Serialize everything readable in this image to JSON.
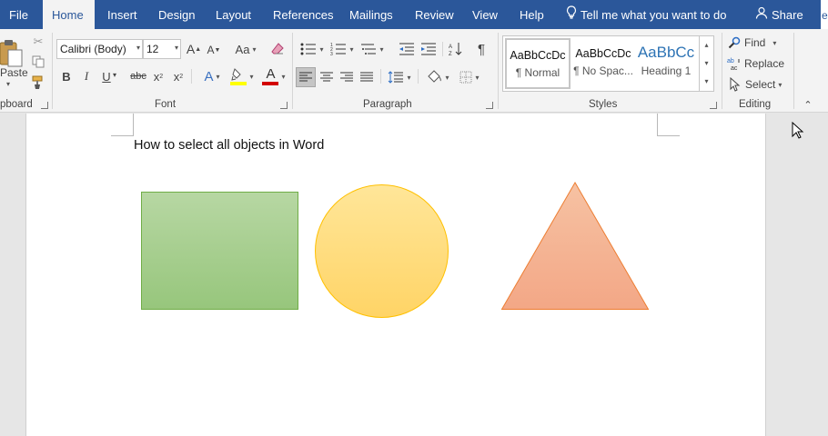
{
  "tabs": [
    {
      "label": "File",
      "active": false
    },
    {
      "label": "Home",
      "active": true
    },
    {
      "label": "Insert",
      "active": false
    },
    {
      "label": "Design",
      "active": false
    },
    {
      "label": "Layout",
      "active": false
    },
    {
      "label": "References",
      "active": false
    },
    {
      "label": "Mailings",
      "active": false
    },
    {
      "label": "Review",
      "active": false
    },
    {
      "label": "View",
      "active": false
    },
    {
      "label": "Help",
      "active": false
    }
  ],
  "tell_me": "Tell me what you want to do",
  "share": "Share",
  "edge_text": "e",
  "clipboard": {
    "paste_label": "Paste",
    "group_label": "pboard"
  },
  "font": {
    "family": "Calibri (Body)",
    "size": "12",
    "group_label": "Font",
    "grow_label": "A",
    "shrink_label": "A",
    "case_label": "Aa",
    "bold": "B",
    "italic": "I",
    "underline": "U",
    "strike": "abc",
    "subscript": "x",
    "superscript": "x",
    "effects": "A",
    "font_color": "A",
    "font_color_hex": "#d20000",
    "highlight_hex": "#ffff00"
  },
  "paragraph": {
    "group_label": "Paragraph",
    "pilcrow": "¶"
  },
  "styles": {
    "group_label": "Styles",
    "items": [
      {
        "sample": "AaBbCcDc",
        "name": "¶ Normal"
      },
      {
        "sample": "AaBbCcDc",
        "name": "¶ No Spac..."
      },
      {
        "sample": "AaBbCc",
        "name": "Heading 1"
      }
    ]
  },
  "editing": {
    "group_label": "Editing",
    "find": "Find",
    "replace": "Replace",
    "select": "Select"
  },
  "document": {
    "title": "How to select all objects in Word"
  },
  "colors": {
    "accent": "#2b579a",
    "square_fill": "#a9d18e",
    "square_stroke": "#70ad47",
    "circle_fill": "#ffd966",
    "circle_stroke": "#ffc000",
    "triangle_fill": "#f4b183",
    "triangle_stroke": "#ed7d31"
  }
}
